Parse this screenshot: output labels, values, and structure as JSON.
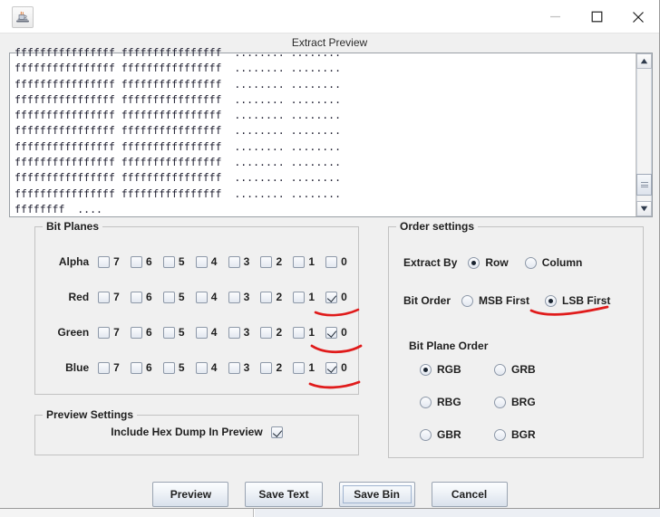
{
  "window": {
    "app_icon": "java-coffee-cup-icon",
    "minimize_label": "minimize-icon",
    "maximize_label": "maximize-icon",
    "close_label": "close-icon",
    "dialog_title": "Extract Preview"
  },
  "preview": {
    "hex_dump": "ffffffffffffffff ffffffffffffffff  ........ ........\nffffffffffffffff ffffffffffffffff  ........ ........\nffffffffffffffff ffffffffffffffff  ........ ........\nffffffffffffffff ffffffffffffffff  ........ ........\nffffffffffffffff ffffffffffffffff  ........ ........\nffffffffffffffff ffffffffffffffff  ........ ........\nffffffffffffffff ffffffffffffffff  ........ ........\nffffffffffffffff ffffffffffffffff  ........ ........\nffffffffffffffff ffffffffffffffff  ........ ........\nffffffffffffffff ffffffffffffffff  ........ ........\nffffffff  ...."
  },
  "scrollbar": {
    "up_icon": "scroll-up-arrow-icon",
    "down_icon": "scroll-down-arrow-icon",
    "thumb": "scrollbar-thumb"
  },
  "bit_planes": {
    "legend": "Bit Planes",
    "bits": [
      "7",
      "6",
      "5",
      "4",
      "3",
      "2",
      "1",
      "0"
    ],
    "rows": [
      {
        "label": "Alpha",
        "checked": [
          false,
          false,
          false,
          false,
          false,
          false,
          false,
          false
        ]
      },
      {
        "label": "Red",
        "checked": [
          false,
          false,
          false,
          false,
          false,
          false,
          false,
          true
        ]
      },
      {
        "label": "Green",
        "checked": [
          false,
          false,
          false,
          false,
          false,
          false,
          false,
          true
        ]
      },
      {
        "label": "Blue",
        "checked": [
          false,
          false,
          false,
          false,
          false,
          false,
          false,
          true
        ]
      }
    ]
  },
  "order_settings": {
    "legend": "Order settings",
    "extract_by": {
      "label": "Extract By",
      "options": [
        "Row",
        "Column"
      ],
      "selected": "Row"
    },
    "bit_order": {
      "label": "Bit Order",
      "options": [
        "MSB First",
        "LSB First"
      ],
      "selected": "LSB First"
    },
    "bit_plane_order": {
      "label": "Bit Plane Order",
      "options": [
        "RGB",
        "GRB",
        "RBG",
        "BRG",
        "GBR",
        "BGR"
      ],
      "selected": "RGB"
    }
  },
  "preview_settings": {
    "legend": "Preview Settings",
    "include_hex_dump_label": "Include Hex Dump In Preview",
    "include_hex_dump_checked": true
  },
  "buttons": [
    {
      "label": "Preview",
      "focused": false
    },
    {
      "label": "Save Text",
      "focused": false
    },
    {
      "label": "Save Bin",
      "focused": true
    },
    {
      "label": "Cancel",
      "focused": false
    }
  ],
  "annotations": {
    "color": "#e01b1b",
    "marks": [
      "underline-red-bit0",
      "underline-green-bit0",
      "underline-blue-bit0",
      "underline-lsb-first"
    ]
  }
}
